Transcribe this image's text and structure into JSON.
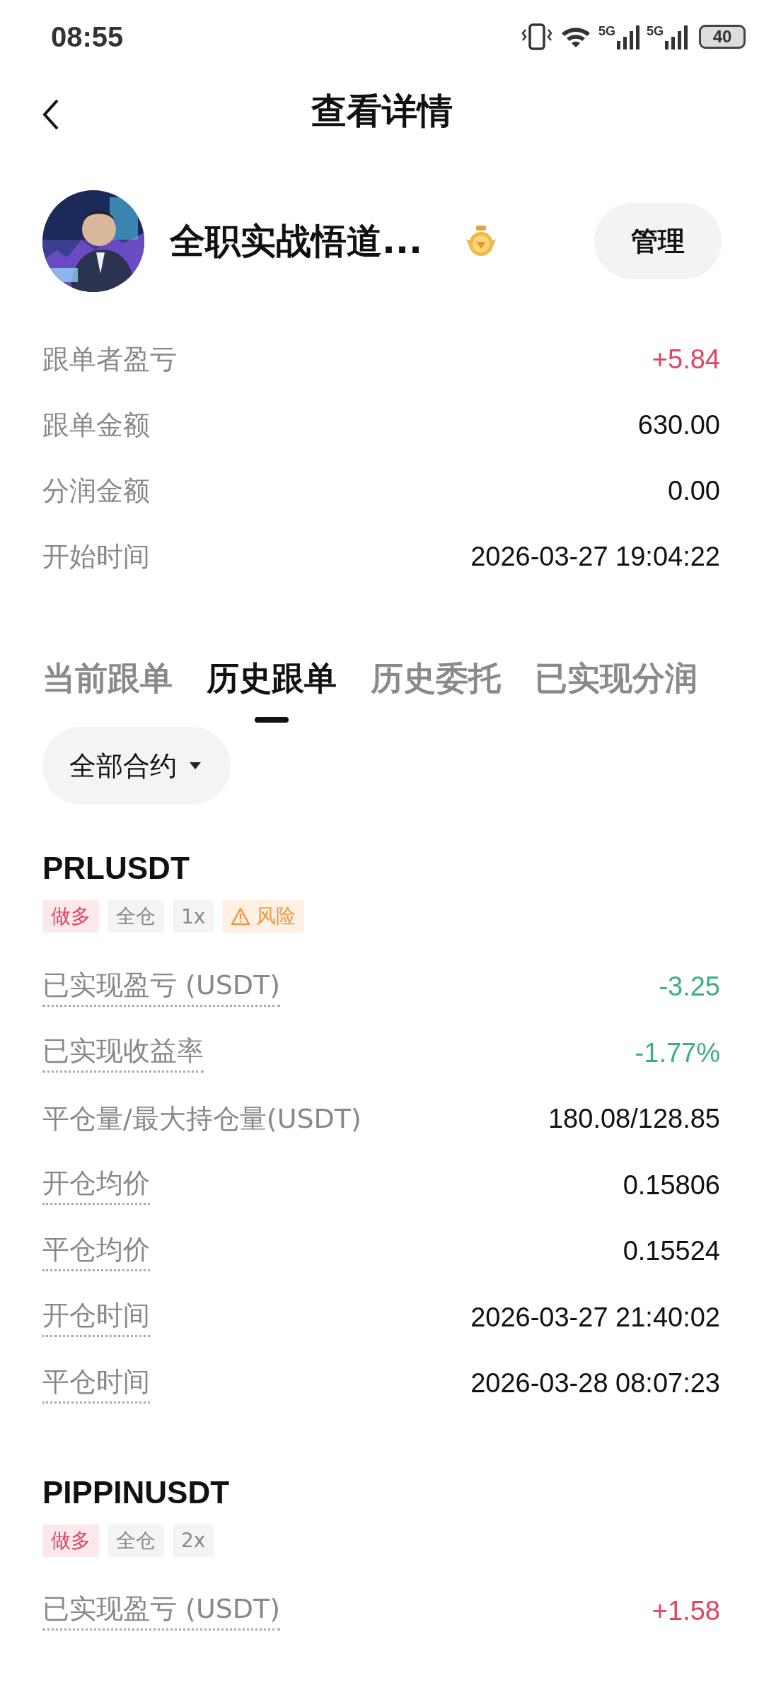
{
  "status_bar": {
    "time": "08:55",
    "networks": [
      "5G",
      "5G"
    ],
    "battery": "40"
  },
  "header": {
    "title": "查看详情"
  },
  "profile": {
    "name": "全职实战悟道...",
    "button": "管理"
  },
  "summary": [
    {
      "label": "跟单者盈亏",
      "value": "+5.84",
      "color": "#e0445f"
    },
    {
      "label": "跟单金额",
      "value": "630.00"
    },
    {
      "label": "分润金额",
      "value": "0.00"
    },
    {
      "label": "开始时间",
      "value": "2026-03-27 19:04:22"
    }
  ],
  "tabs": [
    {
      "label": "当前跟单",
      "selected": false
    },
    {
      "label": "历史跟单",
      "selected": true
    },
    {
      "label": "历史委托",
      "selected": false
    },
    {
      "label": "已实现分润",
      "selected": false
    }
  ],
  "filter": {
    "label": "全部合约"
  },
  "positions": [
    {
      "symbol": "PRLUSDT",
      "tags": [
        {
          "kind": "side",
          "text": "做多"
        },
        {
          "kind": "plain",
          "text": "全仓"
        },
        {
          "kind": "plain",
          "text": "1x"
        },
        {
          "kind": "risk",
          "text": "风险"
        }
      ],
      "rows": [
        {
          "label": "已实现盈亏 (USDT)",
          "value": "-3.25",
          "color": "#3ab07d",
          "dotted": true
        },
        {
          "label": "已实现收益率",
          "value": "-1.77%",
          "color": "#3ab07d",
          "dotted": true
        },
        {
          "label": "平仓量/最大持仓量(USDT)",
          "value": "180.08/128.85",
          "dotted": false
        },
        {
          "label": "开仓均价",
          "value": "0.15806",
          "dotted": true
        },
        {
          "label": "平仓均价",
          "value": "0.15524",
          "dotted": true
        },
        {
          "label": "开仓时间",
          "value": "2026-03-27 21:40:02",
          "dotted": true
        },
        {
          "label": "平仓时间",
          "value": "2026-03-28 08:07:23",
          "dotted": true
        }
      ]
    },
    {
      "symbol": "PIPPINUSDT",
      "tags": [
        {
          "kind": "side",
          "text": "做多"
        },
        {
          "kind": "plain",
          "text": "全仓"
        },
        {
          "kind": "plain",
          "text": "2x"
        }
      ],
      "rows": [
        {
          "label": "已实现盈亏 (USDT)",
          "value": "+1.58",
          "color": "#e0445f",
          "dotted": true
        }
      ]
    }
  ]
}
